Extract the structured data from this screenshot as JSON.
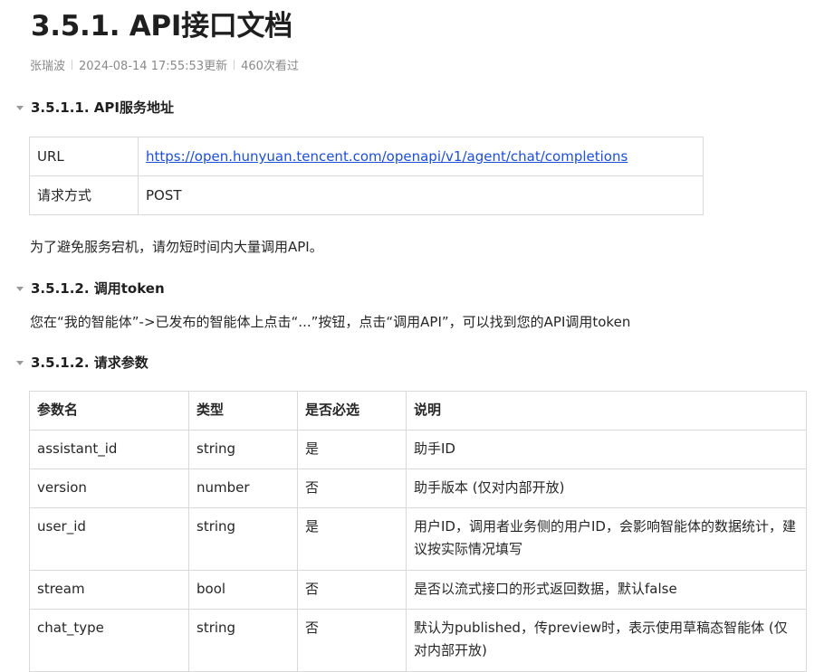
{
  "doc": {
    "title": "3.5.1. API接口文档",
    "author": "张瑞波",
    "updated": "2024-08-14 17:55:53更新",
    "views": "460次看过"
  },
  "sections": [
    {
      "heading": "3.5.1.1. API服务地址"
    },
    {
      "heading": "3.5.1.2. 调用token"
    },
    {
      "heading": "3.5.1.2. 请求参数"
    }
  ],
  "service_table": {
    "rows": [
      {
        "label": "URL",
        "value": "https://open.hunyuan.tencent.com/openapi/v1/agent/chat/completions"
      },
      {
        "label": "请求方式",
        "value": "POST"
      }
    ]
  },
  "notice": "为了避免服务宕机，请勿短时间内大量调用API。",
  "token_text": "您在“我的智能体”->已发布的智能体上点击“...”按钮，点击“调用API”，可以找到您的API调用token",
  "params_table": {
    "headers": [
      "参数名",
      "类型",
      "是否必选",
      "说明"
    ],
    "rows": [
      [
        "assistant_id",
        "string",
        "是",
        "助手ID"
      ],
      [
        "version",
        "number",
        "否",
        "助手版本 (仅对内部开放)"
      ],
      [
        "user_id",
        "string",
        "是",
        "用户ID，调用者业务侧的用户ID，会影响智能体的数据统计，建议按实际情况填写"
      ],
      [
        "stream",
        "bool",
        "否",
        "是否以流式接口的形式返回数据，默认false"
      ],
      [
        "chat_type",
        "string",
        "否",
        "默认为published，传preview时，表示使用草稿态智能体 (仅对内部开放)"
      ]
    ]
  }
}
